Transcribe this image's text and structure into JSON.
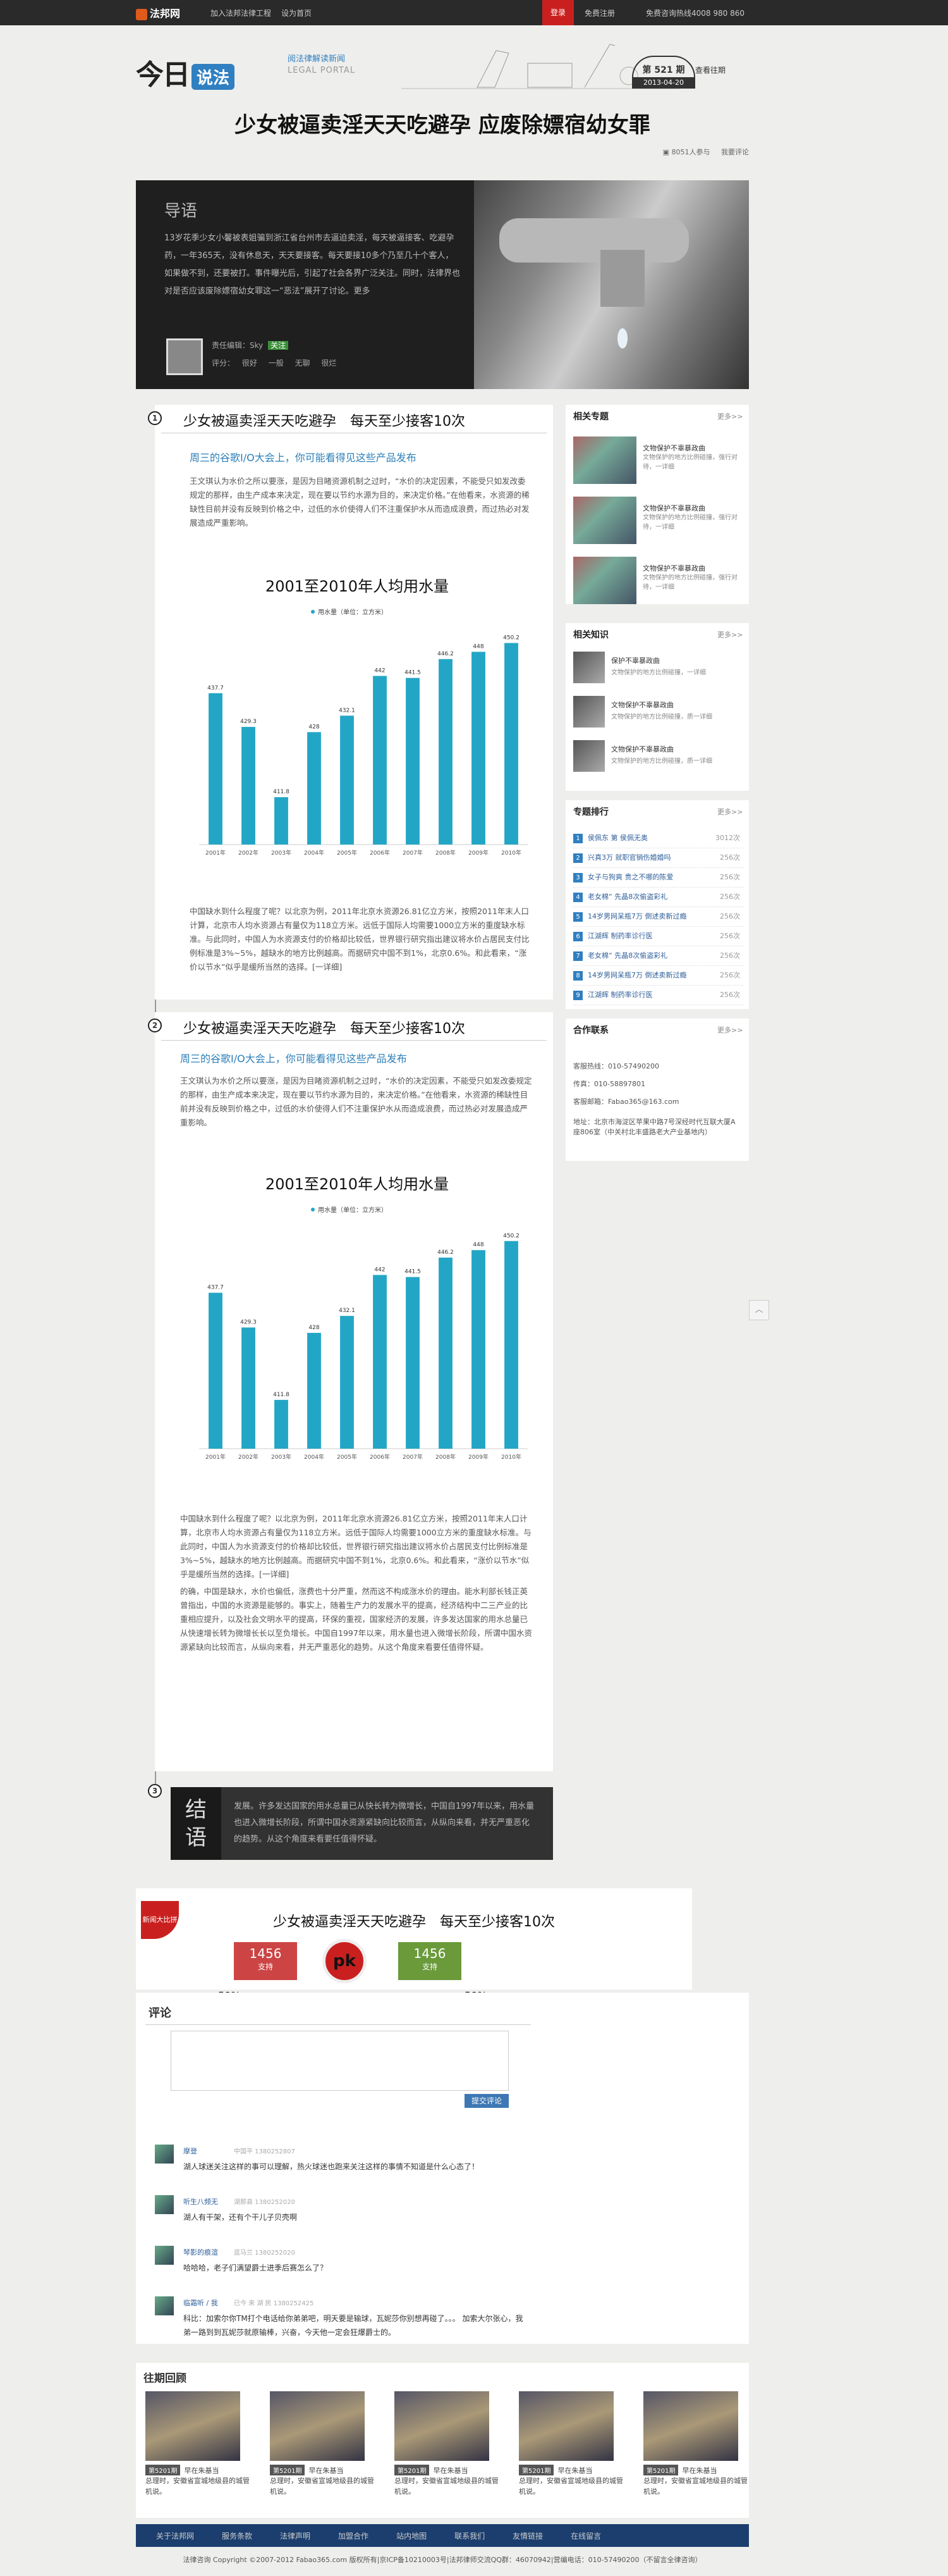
{
  "topbar": {
    "logo": "法邦网",
    "links": [
      "加入法邦法律工程",
      "设为首页"
    ],
    "login": "登录",
    "register": "免费注册",
    "hotline": "免费咨询热线4008 980 860"
  },
  "header": {
    "brand_a": "今日",
    "brand_b": "说法",
    "tagline": "阅法律解读新闻",
    "portal": "LEGAL PORTAL",
    "issue_no": "第 521 期",
    "issue_date": "2013-04-20",
    "prev": "查看往期"
  },
  "title": "少女被逼卖淫天天吃避孕 应废除嫖宿幼女罪",
  "meta": {
    "count": "8051人",
    "count_label": "参与",
    "feedback": "我要评论"
  },
  "intro": {
    "heading": "导语",
    "text": "13岁花季少女小馨被表姐骗到浙江省台州市去逼迫卖淫，每天被逼接客、吃避孕药，一年365天，没有休息天，天天要接客。每天要接10多个乃至几十个客人，如果做不到，还要被打。事件曝光后，引起了社会各界广泛关注。同时，法律界也对是否应该废除嫖宿幼女罪这一“恶法”展开了讨论。更多",
    "editor_label": "责任编辑：Sky",
    "editor_tag": "关注",
    "rate_label": "评分：",
    "rates": [
      "很好",
      "一般",
      "无聊",
      "很烂"
    ]
  },
  "sections": [
    {
      "num": "1",
      "title": "少女被逼卖淫天天吃避孕　每天至少接客10次",
      "sub": "周三的谷歌I/O大会上，你可能看得见这些产品发布",
      "para1": "王文琪认为水价之所以要涨，是因为目睹资源机制之过时，“水价的决定因素，不能受只如发改委规定的那样，由生产成本来决定，现在要以节约水源为目的，来决定价格。”在他看来，水资源的稀缺性目前并没有反映到价格之中，过低的水价使得人们不注重保护水从而造成浪费，而过热必对发展造成严重影响。",
      "para2": "中国缺水到什么程度了呢？以北京为例，2011年北京水资源26.81亿立方米，按照2011年末人口计算，北京市人均水资源占有量仅为118立方米。远低于国际人均需要1000立方米的重度缺水标准。与此同时，中国人为水资源支付的价格却比较低，世界银行研究指出建议将水价占居民支付比例标准是3%~5%，越缺水的地方比例越高。而据研究中国不到1%，北京0.6%。和此看来，“涨价以节水”似乎是缓所当然的选择。[一详细]"
    },
    {
      "num": "2",
      "title": "少女被逼卖淫天天吃避孕　每天至少接客10次",
      "sub": "周三的谷歌I/O大会上，你可能看得见这些产品发布",
      "para1": "王文琪认为水价之所以要涨，是因为目睹资源机制之过时，“水价的决定因素，不能受只如发改委规定的那样，由生产成本来决定，现在要以节约水源为目的，来决定价格。”在他看来，水资源的稀缺性目前并没有反映到价格之中，过低的水价使得人们不注重保护水从而造成浪费，而过热必对发展造成严重影响。",
      "para2": "中国缺水到什么程度了呢？以北京为例，2011年北京水资源26.81亿立方米，按照2011年末人口计算，北京市人均水资源占有量仅为118立方米。远低于国际人均需要1000立方米的重度缺水标准。与此同时，中国人为水资源支付的价格却比较低，世界银行研究指出建议将水价占居民支付比例标准是3%~5%，越缺水的地方比例越高。而据研究中国不到1%，北京0.6%。和此看来，“涨价以节水”似乎是缓所当然的选择。[一详细]",
      "para3": "的确，中国是缺水，水价也偏低，涨费也十分严重，然而这不构成涨水价的理由。能水利部长钱正英曾指出，中国的水资源是能够的。事实上，随着生产力的发展水平的提高，经济结构中二三产业的比重相应提升，以及社会文明水平的提高，环保的重视，国家经济的发展，许多发达国家的用水总量已从快速增长转为微增长长以至负增长。中国自1997年以来，用水量也进入微增长阶段，所谓中国水资源紧缺向比较而言，从纵向来看，并无严重恶化的趋势。从这个角度来看要任值得怀疑。"
    }
  ],
  "chart_data": [
    {
      "type": "bar",
      "title": "2001至2010年人均用水量",
      "legend": "用水量（单位：立方米）",
      "categories": [
        "2001年",
        "2002年",
        "2003年",
        "2004年",
        "2005年",
        "2006年",
        "2007年",
        "2008年",
        "2009年",
        "2010年"
      ],
      "values": [
        437.7,
        429.3,
        411.8,
        428,
        432.1,
        442,
        441.5,
        446.2,
        448,
        450.2
      ],
      "ylim": [
        400,
        452
      ],
      "color": "#23a6c6"
    },
    {
      "type": "bar",
      "title": "2001至2010年人均用水量",
      "legend": "用水量（单位：立方米）",
      "categories": [
        "2001年",
        "2002年",
        "2003年",
        "2004年",
        "2005年",
        "2006年",
        "2007年",
        "2008年",
        "2009年",
        "2010年"
      ],
      "values": [
        437.7,
        429.3,
        411.8,
        428,
        432.1,
        442,
        441.5,
        446.2,
        448,
        450.2
      ],
      "ylim": [
        400,
        452
      ],
      "color": "#23a6c6"
    }
  ],
  "conclusion": {
    "num": "3",
    "label_a": "结",
    "label_b": "语",
    "text": "发展。许多发达国家的用水总量已从快长转为微增长，中国自1997年以来，用水量也进入微增长阶段，所谓中国水资源紧缺向比较而言，从纵向来看，并无严重恶化的趋势。从这个角度来看要任值得怀疑。"
  },
  "vote": {
    "badge": "新闻大比拼",
    "title": "少女被逼卖淫天天吃避孕　每天至少接客10次",
    "left_count": "1456",
    "left_label": "支持",
    "right_count": "1456",
    "right_label": "支持",
    "pk": "pk",
    "left_pct": "50%",
    "right_pct": "50%",
    "left_fraction": 0.5
  },
  "sidebar": {
    "topics": {
      "heading": "相关专题",
      "more": "更多>>",
      "items": [
        {
          "title": "文物保护不辜暴政曲",
          "desc": "文物保护的地方比例碰撞，强行对待，一详细"
        },
        {
          "title": "文物保护不辜暴政曲",
          "desc": "文物保护的地方比例碰撞，强行对待，一详细"
        },
        {
          "title": "文物保护不辜暴政曲",
          "desc": "文物保护的地方比例碰撞，强行对待，一详细"
        }
      ]
    },
    "knowledge": {
      "heading": "相关知识",
      "more": "更多>>",
      "items": [
        {
          "title": "保护不辜暴政曲",
          "desc": "文物保护的地方比例碰撞，一详细"
        },
        {
          "title": "文物保护不辜暴政曲",
          "desc": "文物保护的地方比例碰撞，质一详细"
        },
        {
          "title": "文物保护不辜暴政曲",
          "desc": "文物保护的地方比例碰撞，质一详细"
        }
      ]
    },
    "ranking": {
      "heading": "专题排行",
      "more": "更多>>",
      "items": [
        {
          "n": "1",
          "t": "侯佩东 第 侯佩无奥",
          "c": "3012次"
        },
        {
          "n": "2",
          "t": "兴真3万 就职官销伤婚婚吗",
          "c": "256次"
        },
        {
          "n": "3",
          "t": "女子与狗爽 贵之不哪的陈爱",
          "c": "256次"
        },
        {
          "n": "4",
          "t": "老女棉“ 先晶8次偷盗彩礼",
          "c": "256次"
        },
        {
          "n": "5",
          "t": "14岁男网呆瓶7万 倒述卖新过瘾",
          "c": "256次"
        },
        {
          "n": "6",
          "t": "江湖辉 制药率诊行医",
          "c": "256次"
        },
        {
          "n": "7",
          "t": "老女棉“ 先晶8次偷盗彩礼",
          "c": "256次"
        },
        {
          "n": "8",
          "t": "14岁男网呆瓶7万 倒述卖新过瘾",
          "c": "256次"
        },
        {
          "n": "9",
          "t": "江湖辉 制药率诊行医",
          "c": "256次"
        }
      ]
    },
    "contact": {
      "heading": "合作联系",
      "more": "更多>>",
      "lines": [
        "客服热线：010-57490200",
        "传真：010-58897801",
        "客服邮箱：Fabao365@163.com",
        "地址：北京市海淀区苹果中路7号深经时代互联大厦A座806室（中关村北丰盛路老大产业基地内）"
      ]
    }
  },
  "comments": {
    "heading": "评论",
    "submit": "提交评论",
    "items": [
      {
        "user": "摩登",
        "meta": "中国平  1380252807",
        "text": "湖人球迷关注这样的事可以理解，热火球迷也跑来关注这样的事情不知道是什么心态了！"
      },
      {
        "user": "听生八频无",
        "meta": "湖那县  1380252020",
        "text": "湖人有干架，还有个干儿子贝壳啊"
      },
      {
        "user": "琴影的痕渲",
        "meta": "蓝马兰  1380252020",
        "text": "哈哈哈，老子们满望爵士进季后赛怎么了？"
      },
      {
        "user": "临霜听 / 我",
        "meta": "已今 来 湖 民  1380252425",
        "text": "科比：加索尔你TM打个电话给你弟弟吧，明天要是输球，瓦妮莎你别想再碰了。。。  加索大尔张心，我弟一路到到瓦妮莎就原输棒，兴奋，今天他一定会狂爆爵士的。"
      }
    ]
  },
  "past": {
    "heading": "往期回顾",
    "items": [
      {
        "tag": "第5201期",
        "title": "早在朱基当",
        "desc": "总理时，安徽省宣城地级县的城管机说。"
      },
      {
        "tag": "第5201期",
        "title": "早在朱基当",
        "desc": "总理时，安徽省宣城地级县的城管机说。"
      },
      {
        "tag": "第5201期",
        "title": "早在朱基当",
        "desc": "总理时，安徽省宣城地级县的城管机说。"
      },
      {
        "tag": "第5201期",
        "title": "早在朱基当",
        "desc": "总理时，安徽省宣城地级县的城管机说。"
      },
      {
        "tag": "第5201期",
        "title": "早在朱基当",
        "desc": "总理时，安徽省宣城地级县的城管机说。"
      }
    ]
  },
  "footer": {
    "links": [
      "关于法邦网",
      "服务条款",
      "法律声明",
      "加盟合作",
      "站内地图",
      "联系我们",
      "友情链接",
      "在线留言"
    ],
    "copyright": "法律咨询 Copyright ©2007-2012 Fabao365.com 版权所有|京ICP备10210003号|法邦律师交流QQ群：46070942|营编电话：010-57490200（不留言全律咨询）"
  }
}
